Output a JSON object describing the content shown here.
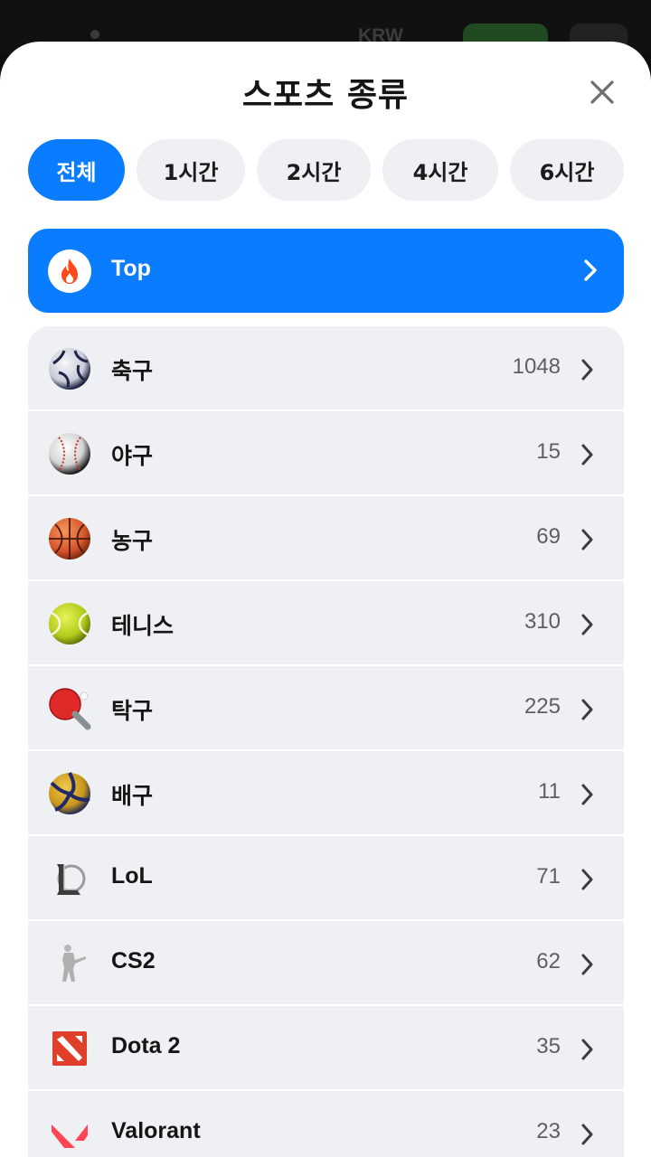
{
  "backdrop": {
    "currency_label": "KRW"
  },
  "sheet": {
    "title": "스포츠 종류",
    "close_icon": "close-icon"
  },
  "filters": [
    {
      "label": "전체",
      "active": true
    },
    {
      "label": "1시간",
      "active": false
    },
    {
      "label": "2시간",
      "active": false
    },
    {
      "label": "4시간",
      "active": false
    },
    {
      "label": "6시간",
      "active": false
    }
  ],
  "top": {
    "label": "Top",
    "icon": "fire-icon"
  },
  "sports": [
    {
      "label": "축구",
      "count": "1048",
      "icon": "soccer-ball-icon"
    },
    {
      "label": "야구",
      "count": "15",
      "icon": "baseball-icon"
    },
    {
      "label": "농구",
      "count": "69",
      "icon": "basketball-icon"
    },
    {
      "label": "테니스",
      "count": "310",
      "icon": "tennis-ball-icon"
    },
    {
      "label": "탁구",
      "count": "225",
      "icon": "table-tennis-paddle-icon"
    },
    {
      "label": "배구",
      "count": "11",
      "icon": "volleyball-icon"
    },
    {
      "label": "LoL",
      "count": "71",
      "icon": "lol-logo-icon"
    },
    {
      "label": "CS2",
      "count": "62",
      "icon": "cs2-soldier-icon"
    },
    {
      "label": "Dota 2",
      "count": "35",
      "icon": "dota2-logo-icon"
    },
    {
      "label": "Valorant",
      "count": "23",
      "icon": "valorant-logo-icon"
    }
  ],
  "colors": {
    "accent": "#0a7cff",
    "chip_bg": "#eef0f3",
    "list_bg": "#eef0f3",
    "count_text": "#5d5f63"
  }
}
